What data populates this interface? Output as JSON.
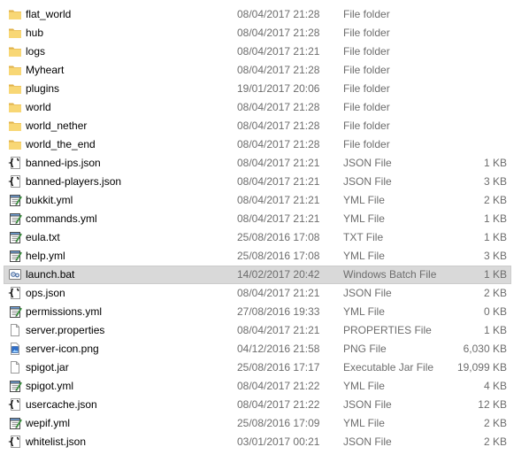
{
  "files": [
    {
      "name": "flat_world",
      "date": "08/04/2017 21:28",
      "type": "File folder",
      "size": "",
      "icon": "folder-icon"
    },
    {
      "name": "hub",
      "date": "08/04/2017 21:28",
      "type": "File folder",
      "size": "",
      "icon": "folder-icon"
    },
    {
      "name": "logs",
      "date": "08/04/2017 21:21",
      "type": "File folder",
      "size": "",
      "icon": "folder-icon"
    },
    {
      "name": "Myheart",
      "date": "08/04/2017 21:28",
      "type": "File folder",
      "size": "",
      "icon": "folder-icon"
    },
    {
      "name": "plugins",
      "date": "19/01/2017 20:06",
      "type": "File folder",
      "size": "",
      "icon": "folder-icon"
    },
    {
      "name": "world",
      "date": "08/04/2017 21:28",
      "type": "File folder",
      "size": "",
      "icon": "folder-icon"
    },
    {
      "name": "world_nether",
      "date": "08/04/2017 21:28",
      "type": "File folder",
      "size": "",
      "icon": "folder-icon"
    },
    {
      "name": "world_the_end",
      "date": "08/04/2017 21:28",
      "type": "File folder",
      "size": "",
      "icon": "folder-icon"
    },
    {
      "name": "banned-ips.json",
      "date": "08/04/2017 21:21",
      "type": "JSON File",
      "size": "1 KB",
      "icon": "json-file-icon"
    },
    {
      "name": "banned-players.json",
      "date": "08/04/2017 21:21",
      "type": "JSON File",
      "size": "3 KB",
      "icon": "json-file-icon"
    },
    {
      "name": "bukkit.yml",
      "date": "08/04/2017 21:21",
      "type": "YML File",
      "size": "2 KB",
      "icon": "notepad-file-icon"
    },
    {
      "name": "commands.yml",
      "date": "08/04/2017 21:21",
      "type": "YML File",
      "size": "1 KB",
      "icon": "notepad-file-icon"
    },
    {
      "name": "eula.txt",
      "date": "25/08/2016 17:08",
      "type": "TXT File",
      "size": "1 KB",
      "icon": "notepad-file-icon"
    },
    {
      "name": "help.yml",
      "date": "25/08/2016 17:08",
      "type": "YML File",
      "size": "3 KB",
      "icon": "notepad-file-icon"
    },
    {
      "name": "launch.bat",
      "date": "14/02/2017 20:42",
      "type": "Windows Batch File",
      "size": "1 KB",
      "icon": "batch-file-icon",
      "selected": true
    },
    {
      "name": "ops.json",
      "date": "08/04/2017 21:21",
      "type": "JSON File",
      "size": "2 KB",
      "icon": "json-file-icon"
    },
    {
      "name": "permissions.yml",
      "date": "27/08/2016 19:33",
      "type": "YML File",
      "size": "0 KB",
      "icon": "notepad-file-icon"
    },
    {
      "name": "server.properties",
      "date": "08/04/2017 21:21",
      "type": "PROPERTIES File",
      "size": "1 KB",
      "icon": "blank-file-icon"
    },
    {
      "name": "server-icon.png",
      "date": "04/12/2016 21:58",
      "type": "PNG File",
      "size": "6,030 KB",
      "icon": "image-file-icon"
    },
    {
      "name": "spigot.jar",
      "date": "25/08/2016 17:17",
      "type": "Executable Jar File",
      "size": "19,099 KB",
      "icon": "blank-file-icon"
    },
    {
      "name": "spigot.yml",
      "date": "08/04/2017 21:22",
      "type": "YML File",
      "size": "4 KB",
      "icon": "notepad-file-icon"
    },
    {
      "name": "usercache.json",
      "date": "08/04/2017 21:22",
      "type": "JSON File",
      "size": "12 KB",
      "icon": "json-file-icon"
    },
    {
      "name": "wepif.yml",
      "date": "25/08/2016 17:09",
      "type": "YML File",
      "size": "2 KB",
      "icon": "notepad-file-icon"
    },
    {
      "name": "whitelist.json",
      "date": "03/01/2017 00:21",
      "type": "JSON File",
      "size": "2 KB",
      "icon": "json-file-icon"
    }
  ],
  "colors": {
    "folder": "#f8d775",
    "folder_dark": "#e0b24a",
    "selection": "#d9d9d9",
    "meta_text": "#6d6d6d"
  }
}
